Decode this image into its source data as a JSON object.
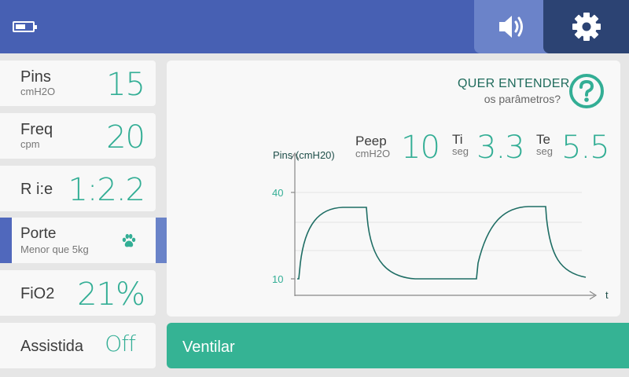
{
  "colors": {
    "header": "#4760b3",
    "accent_teal": "#33ae95",
    "dark_navy": "#2c4373",
    "light_blue": "#6b83c9"
  },
  "header": {
    "battery_icon": "battery-icon",
    "sound_icon": "volume-icon",
    "settings_icon": "gear-icon"
  },
  "params": {
    "pins": {
      "label": "Pins",
      "unit": "cmH2O",
      "value": "15"
    },
    "freq": {
      "label": "Freq",
      "unit": "cpm",
      "value": "20"
    },
    "rie": {
      "label": "R i:e",
      "value": "1:2.2"
    },
    "porte": {
      "label": "Porte",
      "sub": "Menor que 5kg",
      "icon": "paw-icon"
    },
    "fio2": {
      "label": "FiO2",
      "value": "21%"
    },
    "assistida": {
      "label": "Assistida",
      "value": "Off"
    }
  },
  "help": {
    "title": "QUER ENTENDER",
    "subtitle": "os parâmetros?",
    "icon": "help-icon"
  },
  "readouts": {
    "peep": {
      "label": "Peep",
      "unit": "cmH2O",
      "value": "10"
    },
    "ti": {
      "label": "Ti",
      "unit": "seg",
      "value": "3.3"
    },
    "te": {
      "label": "Te",
      "unit": "seg",
      "value": "5.5"
    }
  },
  "chart_data": {
    "type": "line",
    "ylabel": "Pins (cmH20)",
    "xlabel": "t",
    "y_ticks": [
      "40",
      "10"
    ],
    "grid": true
  },
  "actions": {
    "ventilar": "Ventilar"
  }
}
